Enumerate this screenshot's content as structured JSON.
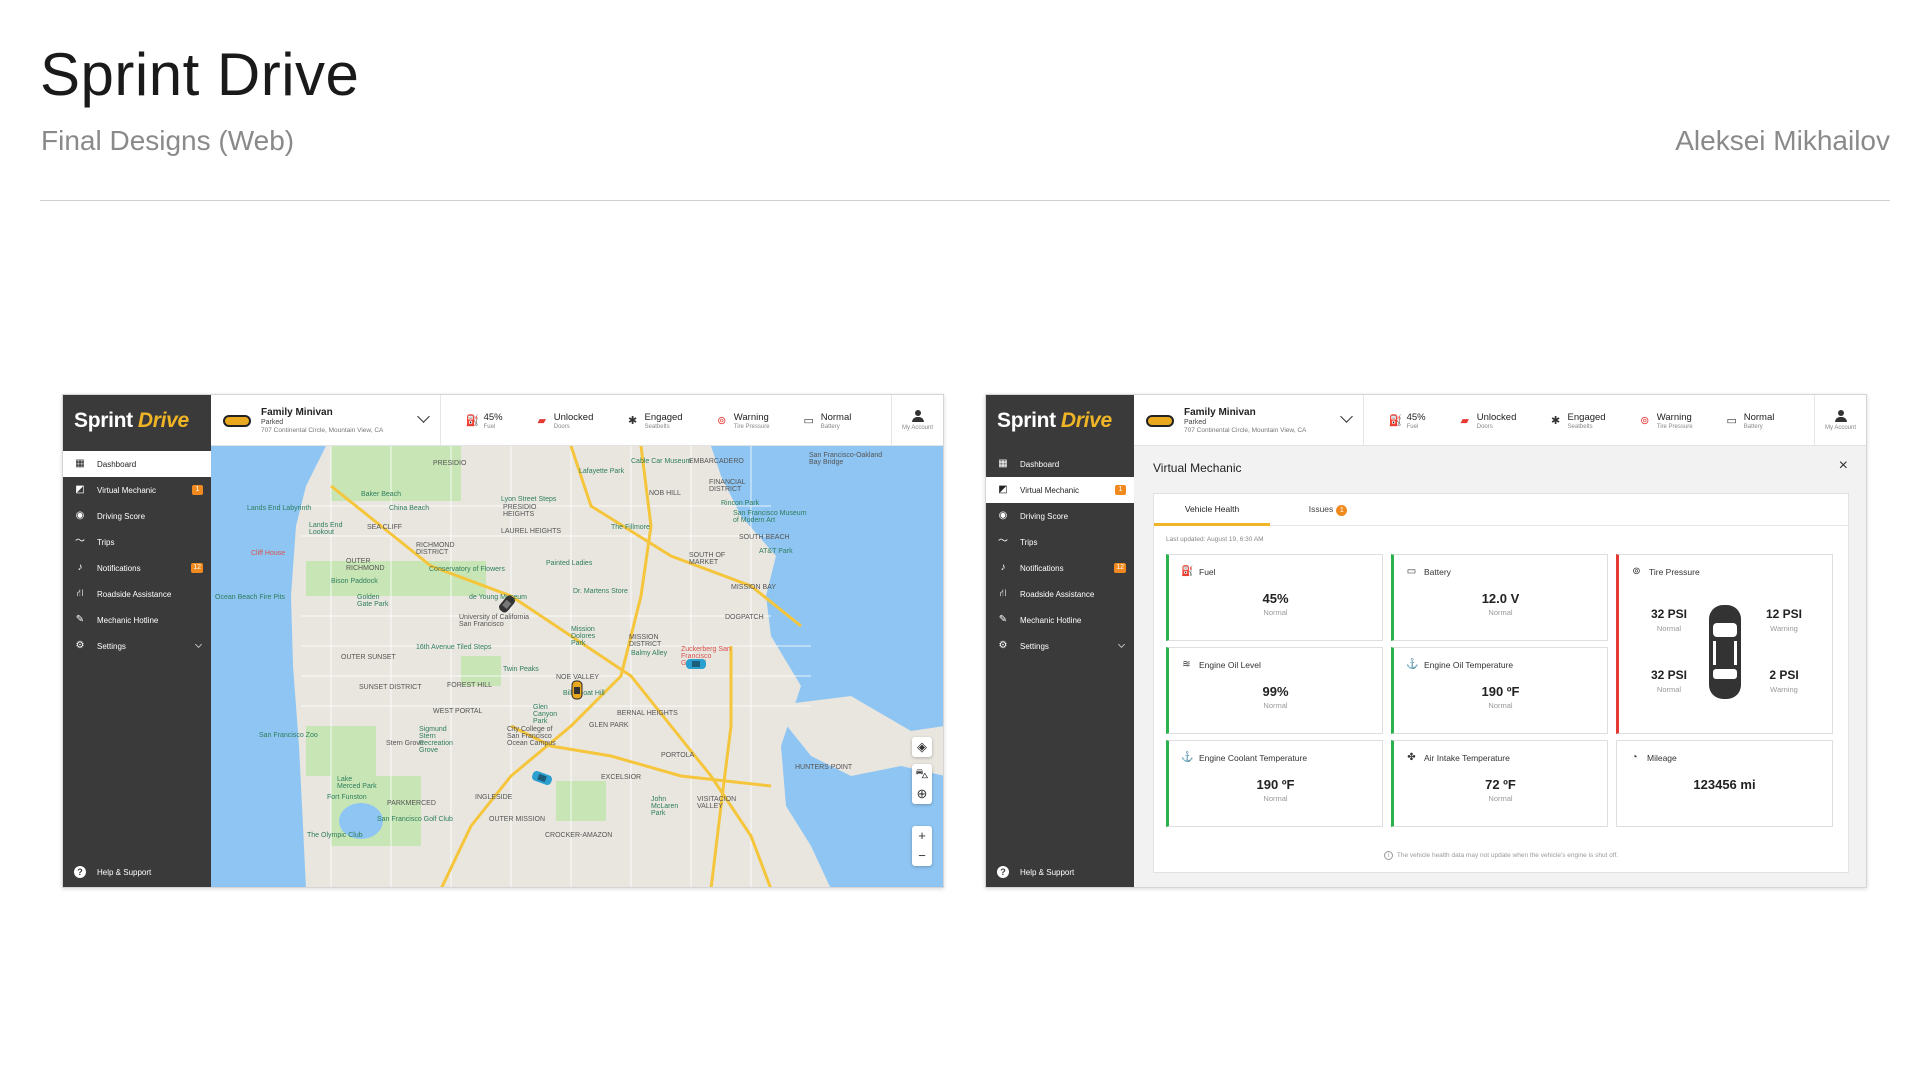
{
  "presentation": {
    "title": "Sprint Drive",
    "subtitle": "Final Designs (Web)",
    "author": "Aleksei Mikhailov"
  },
  "brand": {
    "main": "Sprint",
    "accent": "Drive",
    "accent_color": "#f0b526"
  },
  "vehicle": {
    "name": "Family Minivan",
    "status": "Parked",
    "address": "707 Continental Circle, Mountain View, CA"
  },
  "stats": [
    {
      "icon": "fuel-icon",
      "value": "45%",
      "label": "Fuel"
    },
    {
      "icon": "door-icon",
      "value": "Unlocked",
      "label": "Doors"
    },
    {
      "icon": "seatbelt-icon",
      "value": "Engaged",
      "label": "Seatbelts"
    },
    {
      "icon": "tire-warning-icon",
      "value": "Warning",
      "label": "Tire Pressure"
    },
    {
      "icon": "battery-icon",
      "value": "Normal",
      "label": "Battery"
    }
  ],
  "account": {
    "label": "My Account"
  },
  "nav": {
    "items": [
      {
        "icon": "map-icon",
        "label": "Dashboard"
      },
      {
        "icon": "mechanic-icon",
        "label": "Virtual Mechanic",
        "badge": "1"
      },
      {
        "icon": "score-icon",
        "label": "Driving Score"
      },
      {
        "icon": "trips-icon",
        "label": "Trips"
      },
      {
        "icon": "bell-icon",
        "label": "Notifications",
        "badge": "12"
      },
      {
        "icon": "road-icon",
        "label": "Roadside Assistance"
      },
      {
        "icon": "wrench-icon",
        "label": "Mechanic Hotline"
      },
      {
        "icon": "gear-icon",
        "label": "Settings"
      }
    ],
    "help": "Help & Support"
  },
  "map": {
    "labels": [
      "PRESIDIO",
      "Lafayette Park",
      "Cable Car Museum",
      "EMBARCADERO",
      "San Francisco-Oakland Bay Bridge",
      "Baker Beach",
      "China Beach",
      "Lyon Street Steps",
      "NOB HILL",
      "FINANCIAL DISTRICT",
      "Lands End Labyrinth",
      "PRESIDIO HEIGHTS",
      "Rincon Park",
      "San Francisco Museum of Modern Art",
      "Lands End Lookout",
      "SEA CLIFF",
      "LAUREL HEIGHTS",
      "The Fillmore",
      "SOUTH BEACH",
      "Cliff House",
      "RICHMOND DISTRICT",
      "OUTER RICHMOND",
      "Painted Ladies",
      "SOUTH OF MARKET",
      "AT&T Park",
      "Conservatory of Flowers",
      "Bison Paddock",
      "Dr. Martens Store",
      "MISSION BAY",
      "Ocean Beach Fire Pits",
      "Golden Gate Park",
      "de Young Museum",
      "University of California San Francisco",
      "Mission Dolores Park",
      "MISSION DISTRICT",
      "Zuckerberg San Francisco General",
      "DOGPATCH",
      "OUTER SUNSET",
      "16th Avenue Tiled Steps",
      "Balmy Alley",
      "Twin Peaks",
      "NOE VALLEY",
      "SUNSET DISTRICT",
      "FOREST HILL",
      "Billy Goat Hill",
      "Glen Canyon Park",
      "BERNAL HEIGHTS",
      "WEST PORTAL",
      "San Francisco Zoo",
      "Stern Grove",
      "Sigmund Stern Recreation Grove",
      "City College of San Francisco Ocean Campus",
      "GLEN PARK",
      "PORTOLA",
      "HUNTERS POINT",
      "Lake Merced Park",
      "Fort Funston",
      "PARKMERCED",
      "INGLESIDE",
      "EXCELSIOR",
      "John McLaren Park",
      "VISITACION VALLEY",
      "San Francisco Golf Club",
      "OUTER MISSION",
      "The Olympic Club",
      "CROCKER-AMAZON"
    ],
    "controls": [
      "layers-icon",
      "car-icon",
      "locate-icon",
      "zoom-in-icon",
      "zoom-out-icon"
    ],
    "zoom_in": "+",
    "zoom_out": "−",
    "land_color": "#e9e6df",
    "park_color": "#c8e6b5",
    "water_color": "#8ec5f2",
    "road_color": "#f5c53c"
  },
  "virtual_mechanic": {
    "title": "Virtual Mechanic",
    "close": "×",
    "tabs": [
      {
        "label": "Vehicle Health",
        "active": true
      },
      {
        "label": "Issues",
        "badge": "1"
      }
    ],
    "updated": "Last updated: August 19, 6:30 AM",
    "tiles": [
      {
        "icon": "fuel-icon",
        "label": "Fuel",
        "value": "45%",
        "sub": "Normal",
        "state": "ok"
      },
      {
        "icon": "battery-icon",
        "label": "Battery",
        "value": "12.0 V",
        "sub": "Normal",
        "state": "ok"
      },
      {
        "icon": "oil-level-icon",
        "label": "Engine Oil Level",
        "value": "99%",
        "sub": "Normal",
        "state": "ok"
      },
      {
        "icon": "oil-temp-icon",
        "label": "Engine Oil Temperature",
        "value": "190 ºF",
        "sub": "Normal",
        "state": "ok"
      },
      {
        "icon": "coolant-icon",
        "label": "Engine Coolant Temperature",
        "value": "190 ºF",
        "sub": "Normal",
        "state": "ok"
      },
      {
        "icon": "fan-icon",
        "label": "Air Intake Temperature",
        "value": "72 ºF",
        "sub": "Normal",
        "state": "ok"
      },
      {
        "icon": "gauge-icon",
        "label": "Mileage",
        "value": "123456 mi",
        "sub": "",
        "state": "none"
      }
    ],
    "tire": {
      "label": "Tire Pressure",
      "state": "bad",
      "front_left": {
        "value": "32 PSI",
        "sub": "Normal"
      },
      "front_right": {
        "value": "12 PSI",
        "sub": "Warning"
      },
      "rear_left": {
        "value": "32 PSI",
        "sub": "Normal"
      },
      "rear_right": {
        "value": "2 PSI",
        "sub": "Warning"
      }
    },
    "note": "The vehicle health data may not update when the vehicle's engine is shut off."
  }
}
